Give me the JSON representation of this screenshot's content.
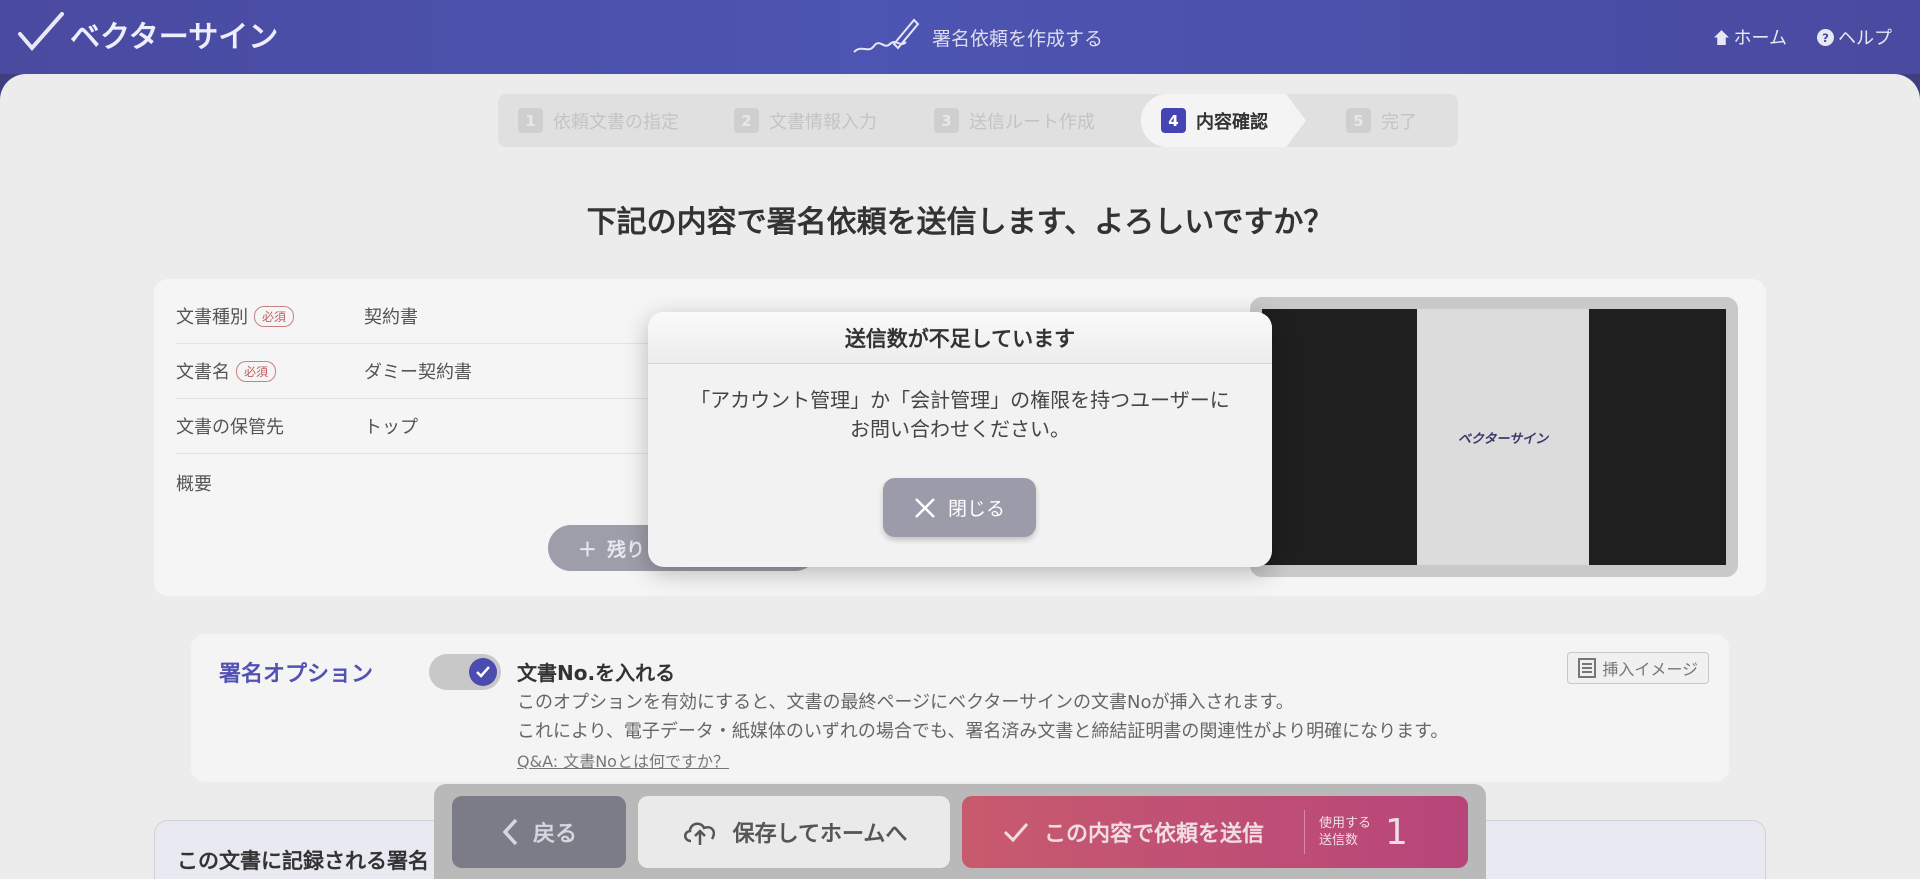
{
  "header": {
    "logo_text": "ベクターサイン",
    "center_title": "署名依頼を作成する",
    "home_label": "ホーム",
    "help_label": "ヘルプ"
  },
  "stepper": {
    "steps": [
      {
        "num": "1",
        "label": "依頼文書の指定"
      },
      {
        "num": "2",
        "label": "文書情報入力"
      },
      {
        "num": "3",
        "label": "送信ルート作成"
      },
      {
        "num": "4",
        "label": "内容確認"
      },
      {
        "num": "5",
        "label": "完了"
      }
    ],
    "active_step": 4
  },
  "question": "下記の内容で署名依頼を送信します、よろしいですか？",
  "document": {
    "rows": [
      {
        "label": "文書種別",
        "required": "必須",
        "value": "契約書"
      },
      {
        "label": "文書名",
        "required": "必須",
        "value": "ダミー契約書"
      },
      {
        "label": "文書の保管先",
        "required": "",
        "value": "トップ"
      },
      {
        "label": "概要",
        "required": "",
        "value": ""
      }
    ],
    "more_button": "残り",
    "preview_logo": "ベクターサイン"
  },
  "signature_option": {
    "title": "署名オプション",
    "toggle_on": true,
    "name": "文書No.を入れる",
    "desc_line1": "このオプションを有効にすると、文書の最終ページにベクターサインの文書Noが挿入されます。",
    "desc_line2": "これにより、電子データ・紙媒体のいずれの場合でも、署名済み文書と締結証明書の関連性がより明確になります。",
    "link": "Q&A: 文書Noとは何ですか？",
    "insert_image": "挿入イメージ"
  },
  "bottom_section": {
    "title": "この文書に記録される署名"
  },
  "actions": {
    "back": "戻る",
    "save_home": "保存してホームへ",
    "send": "この内容で依頼を送信",
    "usage_line1": "使用する",
    "usage_line2": "送信数",
    "usage_count": "1"
  },
  "modal": {
    "title": "送信数が不足しています",
    "message_line1": "「アカウント管理」か「会計管理」の権限を持つユーザーに",
    "message_line2": "お問い合わせください。",
    "close": "閉じる"
  },
  "colors": {
    "brand": "#4c55b2",
    "active_step": "#4444b4",
    "send_button": "#c85a6e"
  }
}
